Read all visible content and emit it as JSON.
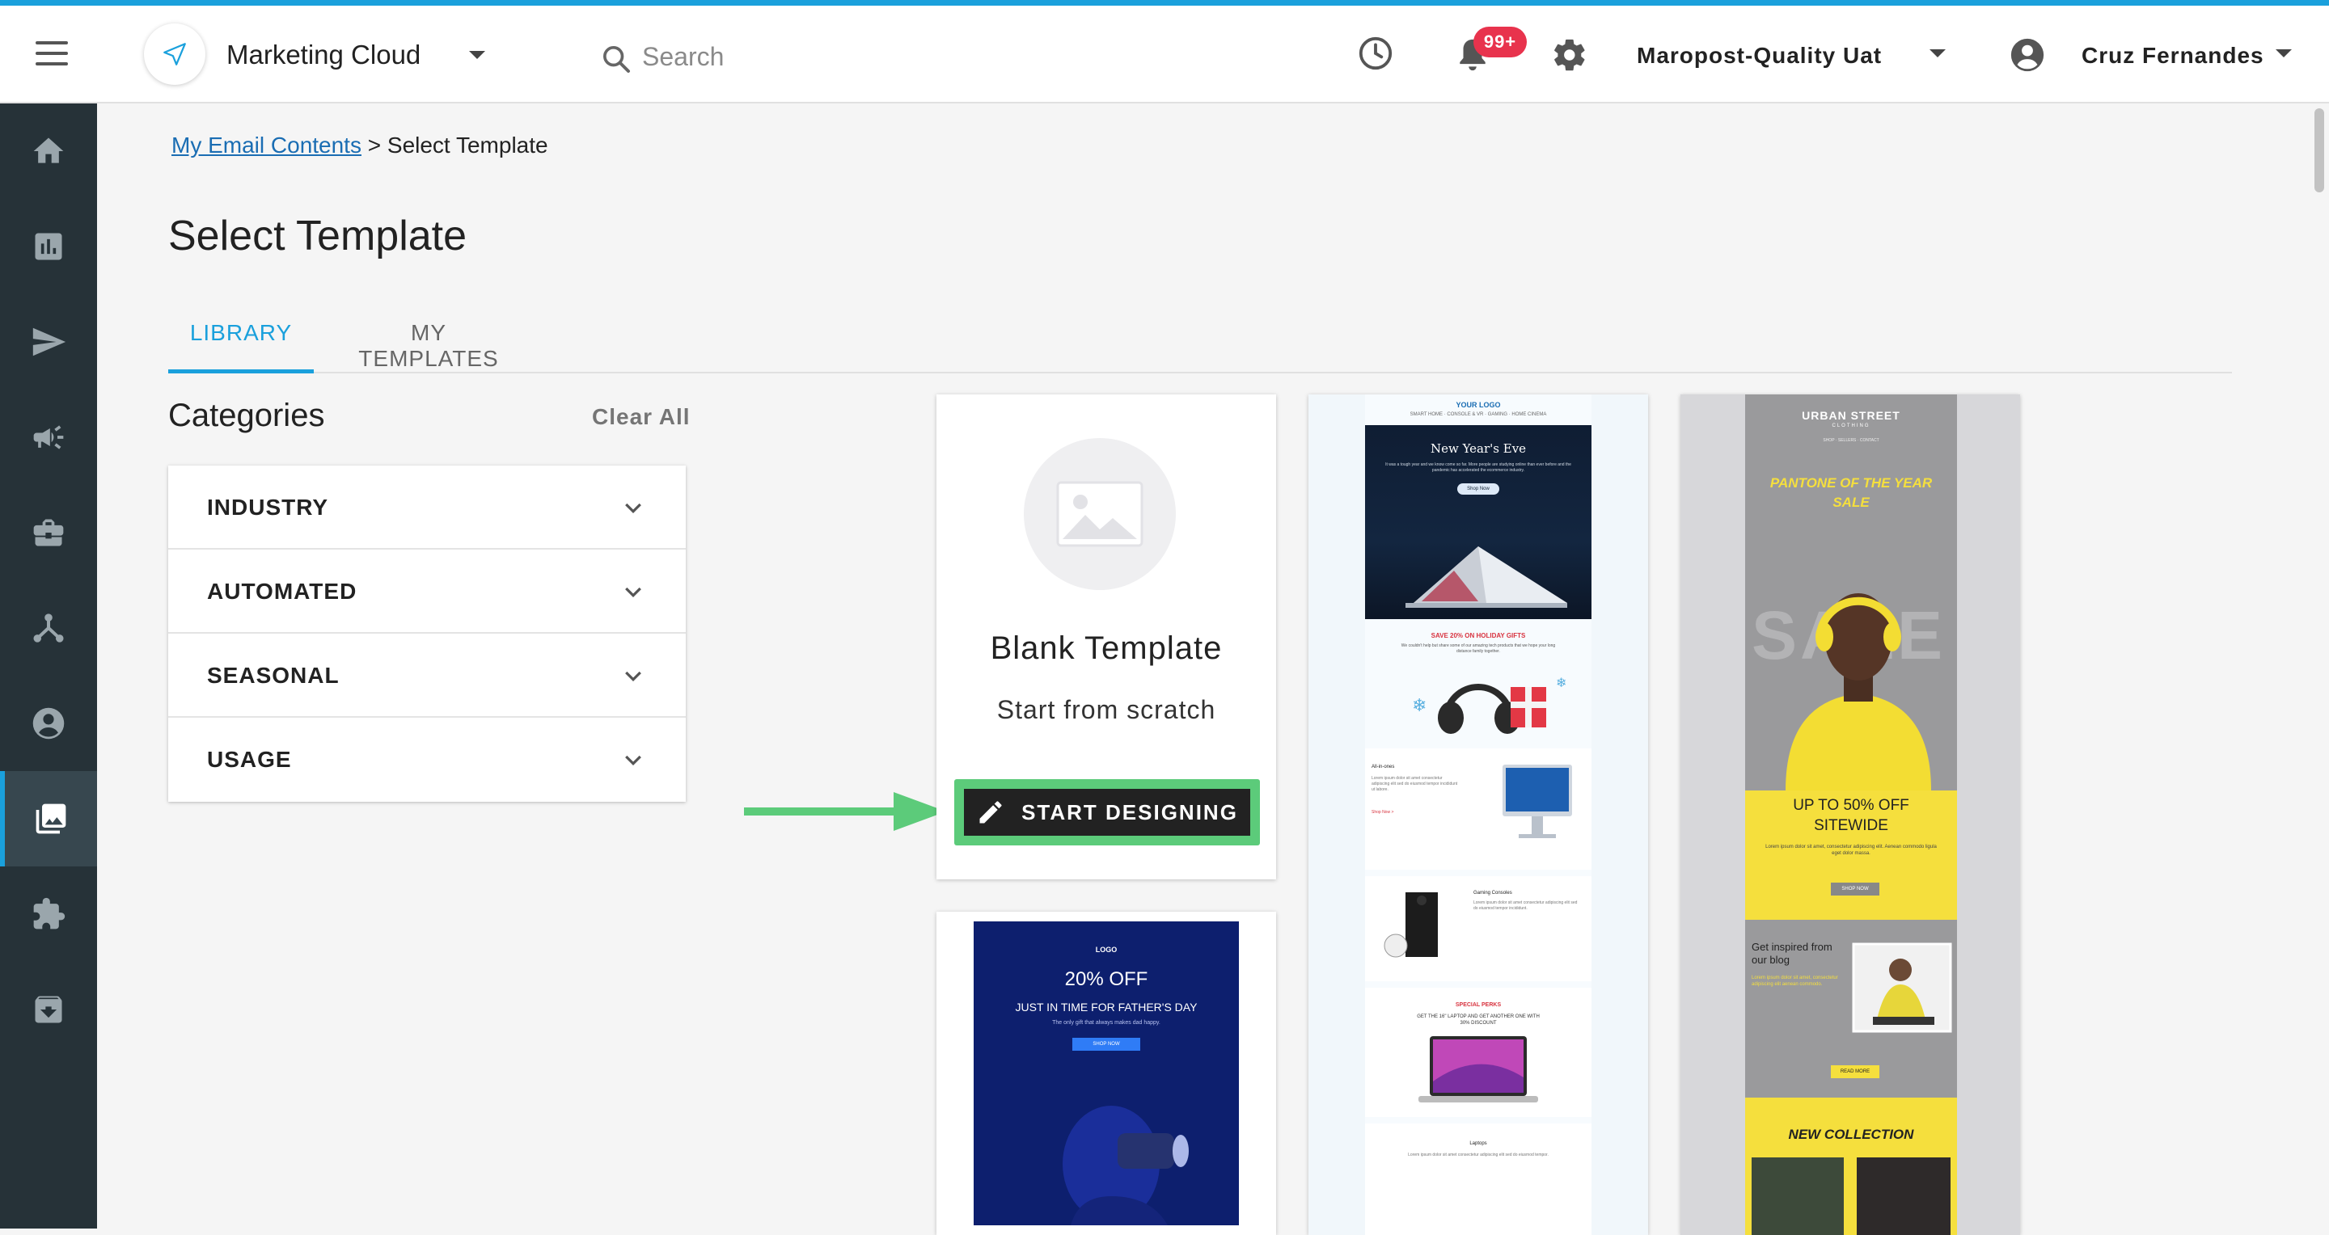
{
  "header": {
    "app_name": "Marketing Cloud",
    "search_placeholder": "Search",
    "notification_count": "99+",
    "org_name": "Maropost-Quality Uat",
    "user_name": "Cruz Fernandes"
  },
  "sidebar": {
    "items": [
      "home-icon",
      "reports-icon",
      "send-icon",
      "campaigns-icon",
      "briefcase-icon",
      "journeys-icon",
      "contacts-icon",
      "content-icon",
      "apps-icon",
      "archive-icon"
    ],
    "active_index": 7
  },
  "breadcrumb": {
    "parent": "My Email Contents",
    "separator": ">",
    "current": "Select Template"
  },
  "page_title": "Select Template",
  "tabs": [
    {
      "label": "LIBRARY",
      "active": true
    },
    {
      "label": "MY TEMPLATES",
      "active": false
    }
  ],
  "categories": {
    "title": "Categories",
    "clear_label": "Clear All",
    "items": [
      "INDUSTRY",
      "AUTOMATED",
      "SEASONAL",
      "USAGE"
    ]
  },
  "blank_template": {
    "title": "Blank Template",
    "subtitle": "Start from scratch",
    "button_label": "START DESIGNING"
  },
  "templates": {
    "holiday": {
      "logo": "YOUR LOGO",
      "nav": "SMART HOME · CONSOLE & VR · GAMING · HOME CINEMA",
      "hero_title": "New Year's Eve",
      "hero_body": "It was a tough year and we know come so far. More people are studying online than ever before and the pandemic has accelerated the ecommerce industry.",
      "hero_button": "Shop Now",
      "promo_title": "SAVE 20% ON HOLIDAY GIFTS",
      "promo_body": "We couldn't help but share some of our amazing tech products that we hope your long distance family together.",
      "section2_title": "All-in-ones",
      "section2_body": "Lorem ipsum dolor sit amet consectetur adipiscing elit sed do eiusmod tempor incididunt ut labore.",
      "shop_link": "Shop Now >",
      "section3_title": "Gaming Consoles",
      "section3_body": "Lorem ipsum dolor sit amet consectetur adipiscing elit sed do eiusmod tempor incididunt.",
      "perks_title": "SPECIAL PERKS",
      "perks_body": "GET THE 16\" LAPTOP AND GET ANOTHER ONE WITH 30% DISCOUNT",
      "section4_title": "Laptops",
      "section4_body": "Lorem ipsum dolor sit amet consectetur adipiscing elit sed do eiusmod tempor."
    },
    "urban": {
      "brand": "URBAN STREET",
      "brand_sub": "CLOTHING",
      "nav": "SHOP · SELLERS · CONTACT",
      "headline": "PANTONE OF THE YEAR SALE",
      "watermark": "SALE",
      "offer": "UP TO 50% OFF SITEWIDE",
      "offer_body": "Lorem ipsum dolor sit amet, consectetur adipiscing elit. Aenean commodo ligula eget dolor massa.",
      "offer_button": "SHOP NOW",
      "blog_title": "Get inspired from our blog",
      "blog_body": "Lorem ipsum dolor sit amet, consectetur adipiscing elit aenean commodo.",
      "blog_button": "READ MORE",
      "collection": "NEW COLLECTION"
    },
    "fathers_day": {
      "logo": "LOGO",
      "headline": "20% OFF",
      "subhead": "JUST IN TIME FOR FATHER'S DAY",
      "body": "The only gift that always makes dad happy.",
      "button": "SHOP NOW"
    }
  },
  "colors": {
    "accent": "#1aa0dc",
    "sidebar_bg": "#263238",
    "notification_badge": "#e8334d",
    "highlight_green": "#5ccb7a",
    "urban_yellow": "#f5df3d"
  }
}
